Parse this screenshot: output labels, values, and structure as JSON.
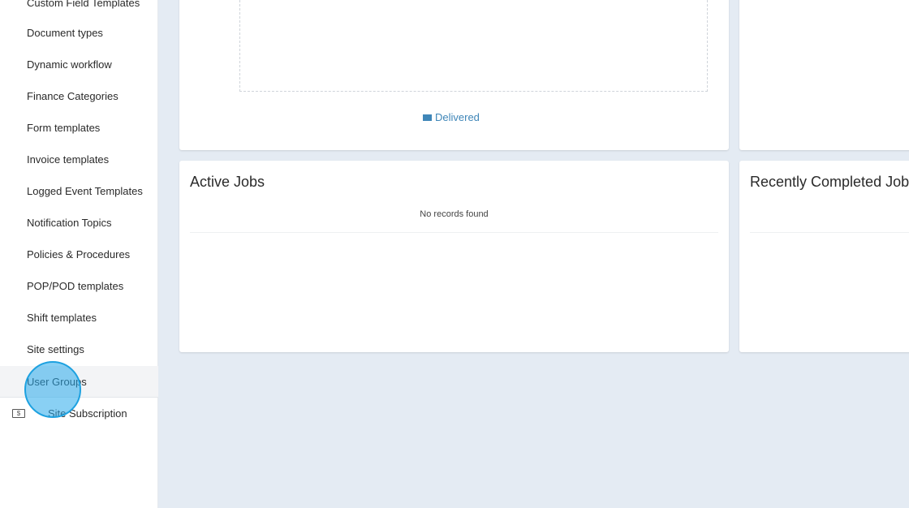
{
  "sidebar": {
    "items": [
      {
        "label": "Custom Field Templates"
      },
      {
        "label": "Document types"
      },
      {
        "label": "Dynamic workflow"
      },
      {
        "label": "Finance Categories"
      },
      {
        "label": "Form templates"
      },
      {
        "label": "Invoice templates"
      },
      {
        "label": "Logged Event Templates"
      },
      {
        "label": "Notification Topics"
      },
      {
        "label": "Policies & Procedures"
      },
      {
        "label": "POP/POD templates"
      },
      {
        "label": "Shift templates"
      },
      {
        "label": "Site settings"
      },
      {
        "label": "User Groups"
      }
    ],
    "subscription": {
      "icon_text": "$",
      "label": "Site Subscription"
    }
  },
  "chart_card": {
    "legend_label": "Delivered",
    "legend_color": "#3f86b8"
  },
  "active_jobs": {
    "title": "Active Jobs",
    "empty_message": "No records found"
  },
  "recent_jobs": {
    "title": "Recently Completed Jobs"
  }
}
